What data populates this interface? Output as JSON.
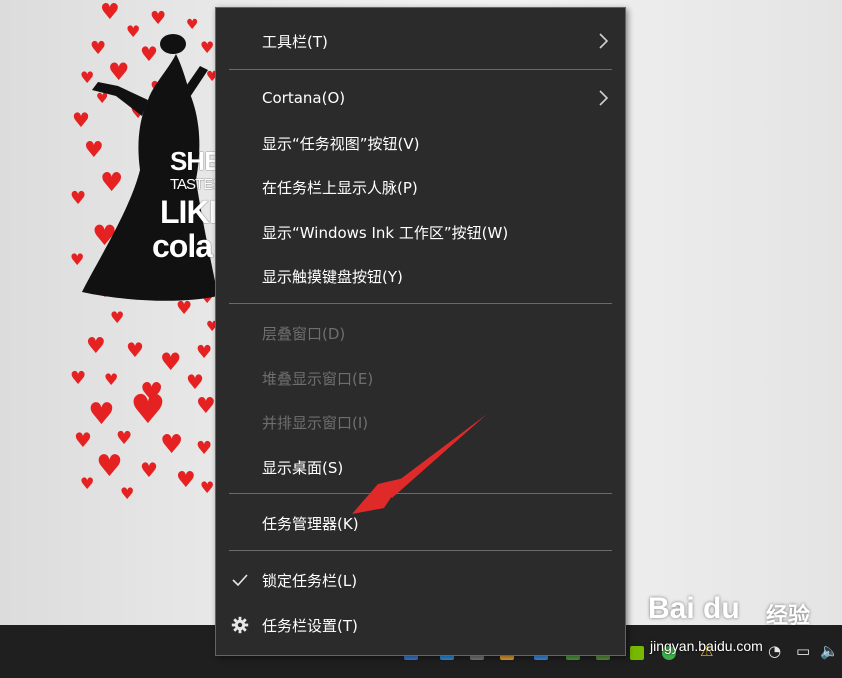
{
  "wallpaper": {
    "text_lines": [
      "SHE",
      "TASTES",
      "LIKE",
      "cola"
    ]
  },
  "menu": {
    "items": [
      {
        "label": "工具栏(T)",
        "enabled": true,
        "submenu": true
      },
      {
        "label": "Cortana(O)",
        "enabled": true,
        "submenu": true
      },
      {
        "label": "显示“任务视图”按钮(V)",
        "enabled": true
      },
      {
        "label": "在任务栏上显示人脉(P)",
        "enabled": true
      },
      {
        "label": "显示“Windows Ink 工作区”按钮(W)",
        "enabled": true
      },
      {
        "label": "显示触摸键盘按钮(Y)",
        "enabled": true
      },
      {
        "label": "层叠窗口(D)",
        "enabled": false
      },
      {
        "label": "堆叠显示窗口(E)",
        "enabled": false
      },
      {
        "label": "并排显示窗口(I)",
        "enabled": false
      },
      {
        "label": "显示桌面(S)",
        "enabled": true
      },
      {
        "label": "任务管理器(K)",
        "enabled": true
      },
      {
        "label": "锁定任务栏(L)",
        "enabled": true,
        "checked": true,
        "lead_icon": "checkmark-icon"
      },
      {
        "label": "任务栏设置(T)",
        "enabled": true,
        "lead_icon": "gear-icon"
      }
    ]
  },
  "watermark": {
    "brand": "Bai du",
    "experience": "经验",
    "url": "jingyan.baidu.com"
  },
  "colors": {
    "menu_bg": "#2b2b2b",
    "menu_text": "#ffffff",
    "disabled_text": "#6e6e6e",
    "arrow": "#e02a2a",
    "taskbar": "#1f1f1f"
  }
}
